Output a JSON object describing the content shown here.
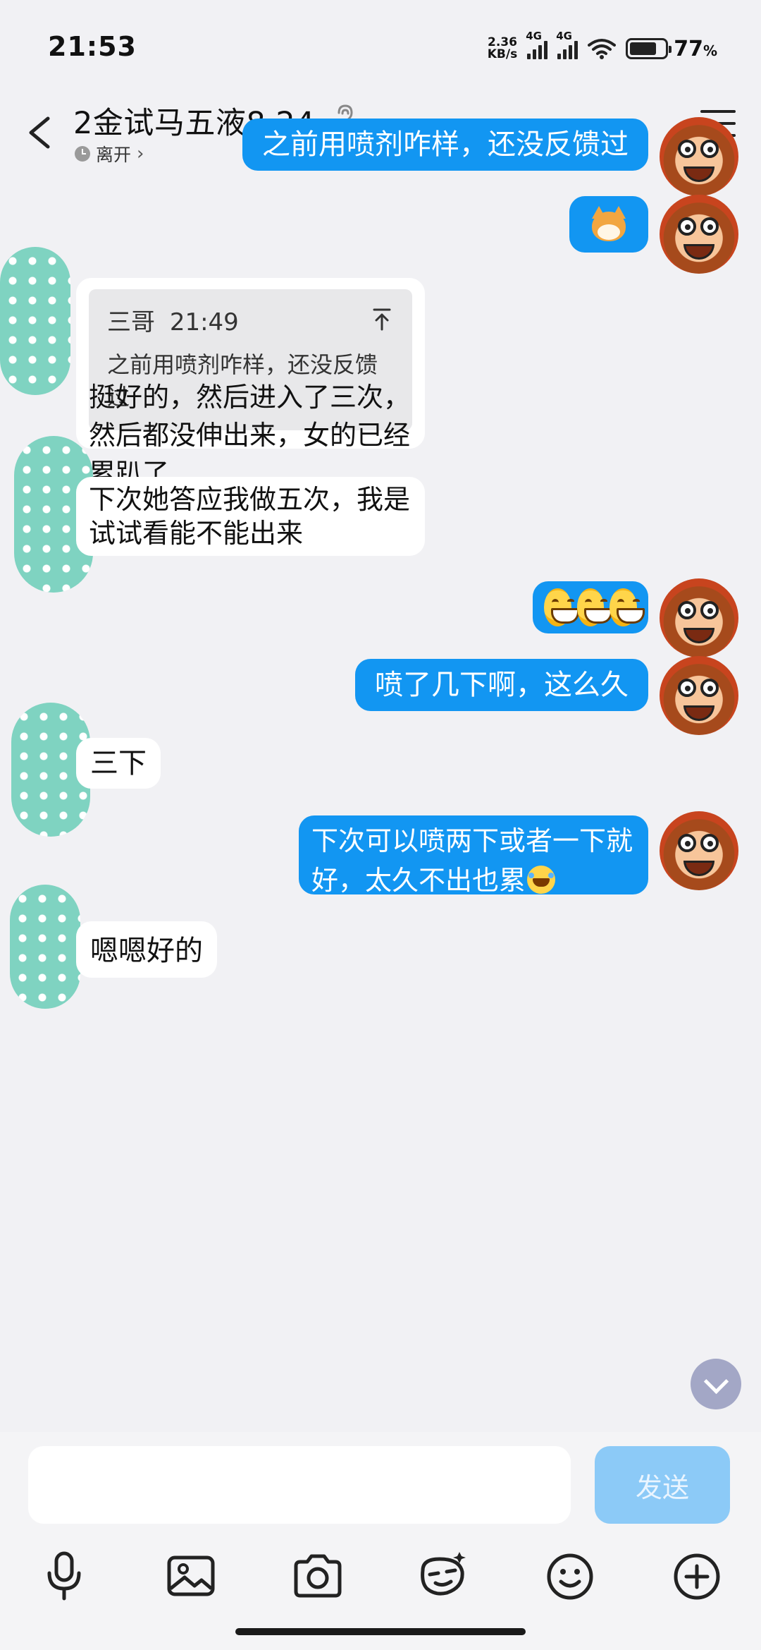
{
  "status_bar": {
    "time": "21:53",
    "net_speed_value": "2.36",
    "net_speed_unit": "KB/s",
    "sim1_label": "4G",
    "sim2_label": "4G",
    "battery_percent": "77",
    "battery_percent_sign": "%"
  },
  "header": {
    "title": "2金试马五液8.24",
    "presence": "离开"
  },
  "messages": [
    {
      "side": "me",
      "text": "之前用喷剂咋样，还没反馈过"
    },
    {
      "side": "me",
      "sticker": "cat-sticker"
    },
    {
      "side": "other",
      "quote": {
        "author": "三哥",
        "time": "21:49",
        "text": "之前用喷剂咋样，还没反馈过"
      },
      "text": "挺好的，然后进入了三次，然后都没伸出来，女的已经累趴了"
    },
    {
      "side": "other",
      "text": "下次她答应我做五次，我是试试看能不能出来"
    },
    {
      "side": "me",
      "emoji": [
        "grin-face",
        "grin-face",
        "grin-face"
      ]
    },
    {
      "side": "me",
      "text": "喷了几下啊，这么久"
    },
    {
      "side": "other",
      "text": "三下"
    },
    {
      "side": "me",
      "text": "下次可以喷两下或者一下就好，太久不出也累",
      "trailing_emoji": "tears-of-joy"
    },
    {
      "side": "other",
      "text": "嗯嗯好的"
    }
  ],
  "composer": {
    "input_value": "",
    "send_label": "发送"
  },
  "toolbar_icons": [
    "microphone-icon",
    "image-icon",
    "camera-icon",
    "sticker-icon",
    "emoji-icon",
    "plus-icon"
  ],
  "colors": {
    "sent_bubble": "#1296f2",
    "received_bubble": "#ffffff",
    "background": "#f1f1f4",
    "send_button_disabled": "#8ccaf7"
  }
}
